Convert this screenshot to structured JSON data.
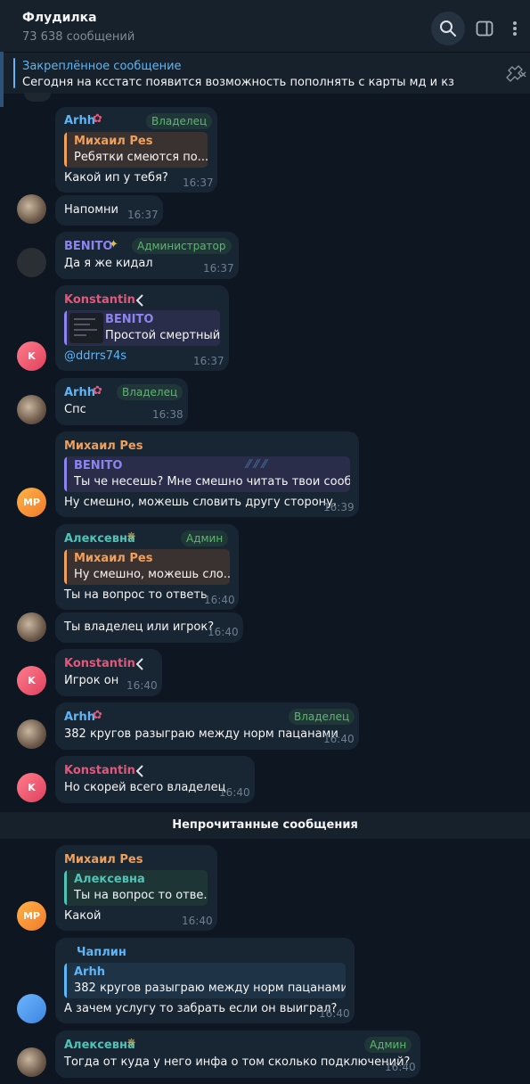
{
  "header": {
    "title": "Флудилка",
    "subtitle": "73 638 сообщений"
  },
  "pinned": {
    "label": "Закреплённое сообщение",
    "text": "Сегодня на ксстатс появится возможность пополнять с карты мд и кз"
  },
  "unread_divider": "Непрочитанные сообщения",
  "messages": [
    {
      "name": "Arhh",
      "badge": "Владелец",
      "reply_name": "Михаил Pes",
      "reply_text": "Ребятки смеются по...",
      "text": "Какой ип у тебя?",
      "time": "16:37"
    },
    {
      "text": "Напомни",
      "time": "16:37"
    },
    {
      "name": "BENITO",
      "badge": "Администратор",
      "text": "Да я же кидал",
      "time": "16:37"
    },
    {
      "name": "Konstantin",
      "reply_name": "BENITO",
      "reply_text": "Простой смертный)",
      "text": "@ddrrs74s",
      "time": "16:37",
      "avatar": "K"
    },
    {
      "name": "Arhh",
      "badge": "Владелец",
      "text": "Спс",
      "time": "16:38"
    },
    {
      "name": "Михаил Pes",
      "reply_name": "BENITO",
      "reply_text": "Ты че несешь? Мне смешно читать твои сооб...",
      "text": "Ну смешно, можешь словить другу сторону.",
      "time": "16:39",
      "avatar": "MP"
    },
    {
      "name": "Алексевна",
      "badge": "Админ",
      "reply_name": "Михаил Pes",
      "reply_text": "Ну смешно, можешь сло...",
      "text": "Ты на вопрос то ответь",
      "time": "16:40"
    },
    {
      "text": "Ты владелец или игрок?",
      "time": "16:40"
    },
    {
      "name": "Konstantin",
      "text": "Игрок он",
      "time": "16:40",
      "avatar": "K"
    },
    {
      "name": "Arhh",
      "badge": "Владелец",
      "text": "382 кругов разыграю между норм пацанами",
      "time": "16:40"
    },
    {
      "name": "Konstantin",
      "text": "Но скорей всего владелец",
      "time": "16:40",
      "avatar": "K"
    },
    {
      "name": "Михаил Pes",
      "reply_name": "Алексевна",
      "reply_text": "Ты на вопрос то отве...",
      "text": "Какой",
      "time": "16:40",
      "avatar": "MP"
    },
    {
      "name": "Чаплин",
      "reply_name": "Arhh",
      "reply_text": "382 кругов разыграю между норм пацанами",
      "text": "А зачем услугу то забрать если он выиграл?",
      "time": "16:40"
    },
    {
      "name": "Алексевна",
      "badge": "Админ",
      "text": "Тогда от куда у него инфа о том сколько подключений?",
      "time": "16:40"
    }
  ],
  "colors": {
    "bg": "#0e1621",
    "bubble": "#182533",
    "accent": "#5eb5f7",
    "badge": "#5cb86c"
  },
  "icons": [
    "search-icon",
    "sidebar-toggle-icon",
    "more-vertical-icon",
    "unpin-icon",
    "chevron-left-icon"
  ]
}
